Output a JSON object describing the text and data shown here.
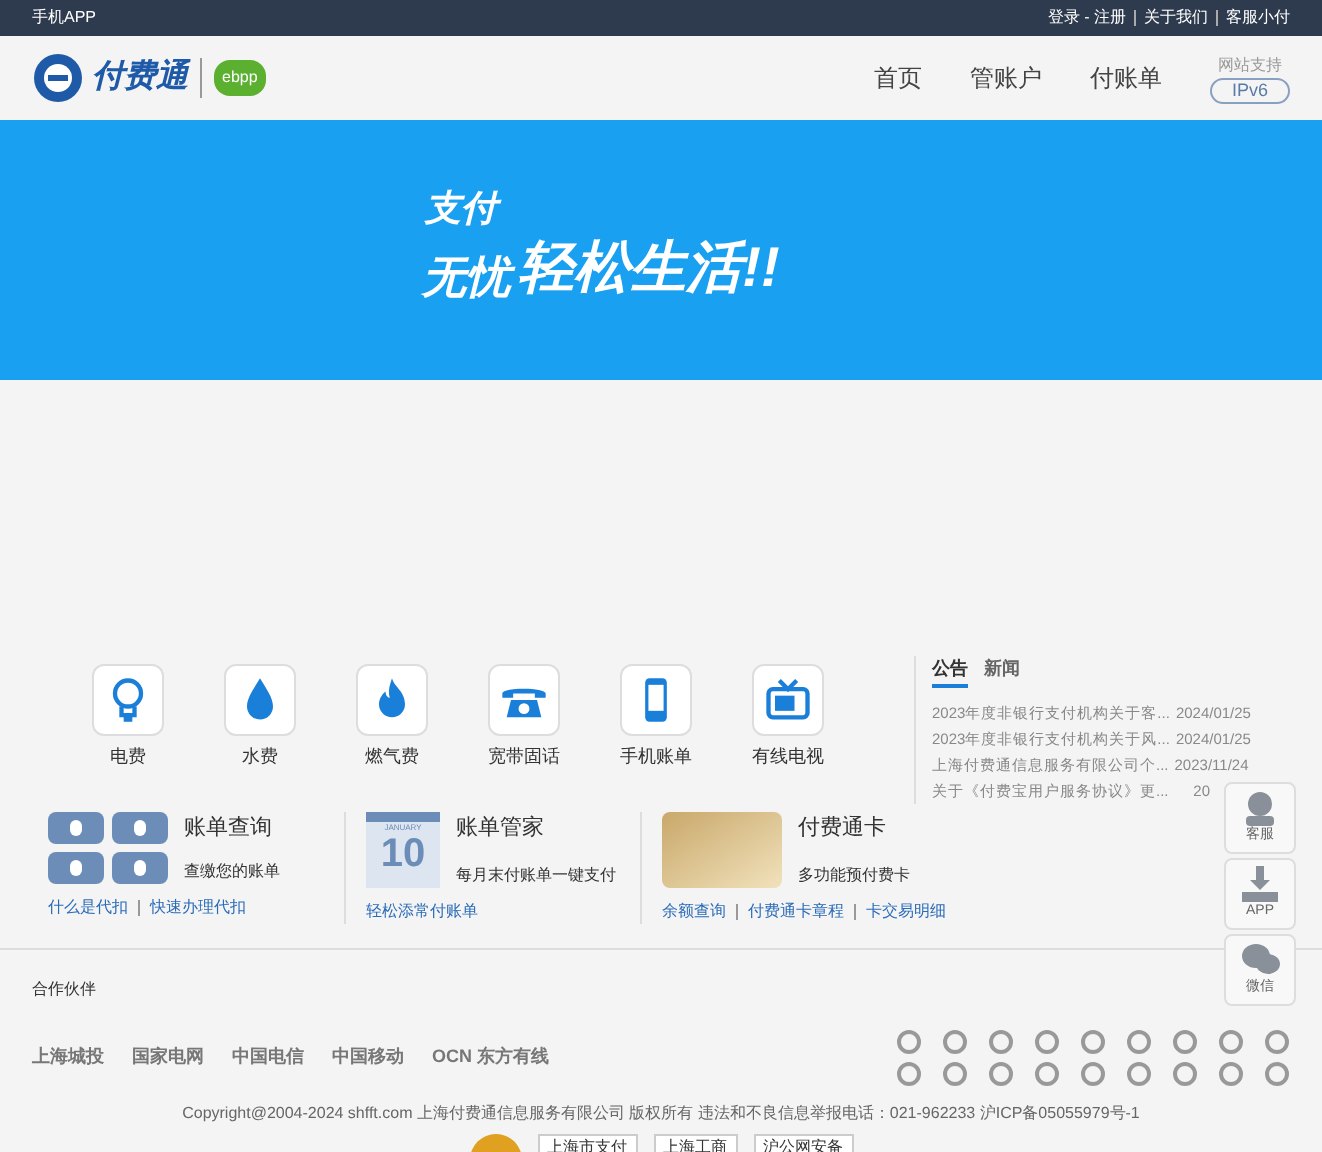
{
  "top_bar": {
    "app_link": "手机APP",
    "links": [
      "登录 - 注册",
      "关于我们",
      "客服小付"
    ]
  },
  "header": {
    "logo_text": "付费通",
    "badge_text": "ebpp",
    "nav": [
      {
        "label": "首页",
        "selected": false
      },
      {
        "label": "管账户",
        "selected": false
      },
      {
        "label": "付账单",
        "selected": false
      }
    ],
    "ipv6_caption": "网站支持",
    "ipv6_badge": "IPv6"
  },
  "banner": {
    "line_1": "支付",
    "line_2a": "无忧",
    "line_2b": "轻松生活!!"
  },
  "services": [
    {
      "kind": "bulb",
      "label": "电费"
    },
    {
      "kind": "drop",
      "label": "水费"
    },
    {
      "kind": "flame",
      "label": "燃气费"
    },
    {
      "kind": "phone",
      "label": "宽带固话"
    },
    {
      "kind": "mobile",
      "label": "手机账单"
    },
    {
      "kind": "tv",
      "label": "有线电视"
    }
  ],
  "news": {
    "tabs": [
      {
        "label": "公告",
        "selected": true
      },
      {
        "label": "新闻",
        "selected": false
      }
    ],
    "items": [
      {
        "title": "2023年度非银行支付机构关于客...",
        "date": "2024/01/25"
      },
      {
        "title": "2023年度非银行支付机构关于风...",
        "date": "2024/01/25"
      },
      {
        "title": "上海付费通信息服务有限公司个...",
        "date": "2023/11/24"
      },
      {
        "title": "关于《付费宝用户服务协议》更...",
        "date": "20"
      }
    ]
  },
  "features": [
    {
      "kind": "tiles",
      "title": "账单查询",
      "subtitle": "查缴您的账单",
      "links": [
        "什么是代扣",
        "快速办理代扣"
      ]
    },
    {
      "kind": "calendar",
      "title": "账单管家",
      "subtitle": "每月末付账单一键支付",
      "calendar_month": "JANUARY",
      "calendar_day": "10",
      "links": [
        "轻松添常付账单"
      ]
    },
    {
      "kind": "card",
      "title": "付费通卡",
      "subtitle": "多功能预付费卡",
      "links": [
        "余额查询",
        "付费通卡章程",
        "卡交易明细"
      ]
    }
  ],
  "side_float": [
    {
      "kind": "agent",
      "label": "客服"
    },
    {
      "kind": "download",
      "label": "APP"
    },
    {
      "kind": "chat",
      "label": "微信"
    }
  ],
  "partners": {
    "heading": "合作伙伴",
    "logos": [
      "上海城投",
      "国家电网",
      "中国电信",
      "中国移动",
      "OCN 东方有线"
    ]
  },
  "copyright": "Copyright@2004-2024 shfft.com 上海付费通信息服务有限公司 版权所有  违法和不良信息举报电话：021-962233  沪ICP备05055979号-1",
  "badges": [
    {
      "kind": "seal"
    },
    {
      "kind": "text",
      "label": "上海市支付"
    },
    {
      "kind": "text",
      "label": "上海工商"
    },
    {
      "kind": "text",
      "label": "沪公网安备"
    }
  ]
}
